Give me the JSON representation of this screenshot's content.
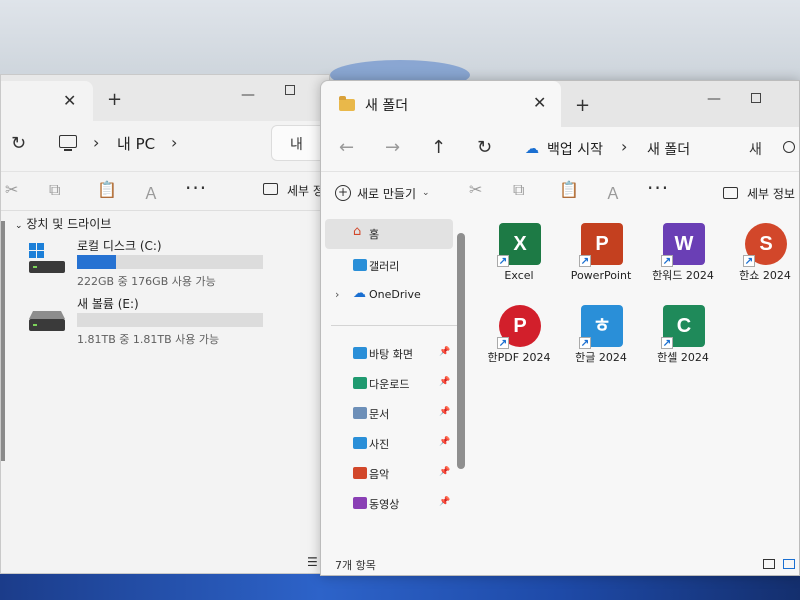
{
  "back_window": {
    "breadcrumb": "내 PC",
    "search_fragment": "내",
    "details_label": "세부 정",
    "section_title": "장치 및 드라이브",
    "drives": [
      {
        "name": "로컬 디스크 (C:)",
        "size_text": "222GB 중 176GB 사용 가능",
        "used_fraction": 0.21
      },
      {
        "name": "새 볼륨 (E:)",
        "size_text": "1.81TB 중 1.81TB 사용 가능",
        "used_fraction": 0.0
      }
    ]
  },
  "front_window": {
    "tab_title": "새 폴더",
    "breadcrumb": [
      "백업 시작",
      "새 폴더"
    ],
    "search_fragment": "새",
    "new_button_label": "새로 만들기",
    "details_label": "세부 정보",
    "sidebar": {
      "items": [
        {
          "label": "홈",
          "icon": "home-icon",
          "selected": true
        },
        {
          "label": "갤러리",
          "icon": "gallery-icon"
        },
        {
          "label": "OneDrive",
          "icon": "cloud-icon"
        },
        {
          "label": "바탕 화면",
          "icon": "desktop-folder-icon",
          "pinned": true
        },
        {
          "label": "다운로드",
          "icon": "downloads-folder-icon",
          "pinned": true
        },
        {
          "label": "문서",
          "icon": "documents-folder-icon",
          "pinned": true
        },
        {
          "label": "사진",
          "icon": "pictures-folder-icon",
          "pinned": true
        },
        {
          "label": "음악",
          "icon": "music-folder-icon",
          "pinned": true
        },
        {
          "label": "동영상",
          "icon": "videos-folder-icon",
          "pinned": true
        }
      ]
    },
    "files": [
      {
        "label": "Excel",
        "glyph": "X",
        "color": "#1d7a45",
        "icon": "excel-icon"
      },
      {
        "label": "PowerPoint",
        "glyph": "P",
        "color": "#c4401f",
        "icon": "powerpoint-icon"
      },
      {
        "label": "한워드 2024",
        "glyph": "W",
        "color": "#6a3fb5",
        "icon": "hanword-icon"
      },
      {
        "label": "한쇼 2024",
        "glyph": "S",
        "color": "#d2472a",
        "icon": "hanshow-icon"
      },
      {
        "label": "한PDF 2024",
        "glyph": "P",
        "color": "#d21f2b",
        "icon": "hanpdf-icon"
      },
      {
        "label": "한글 2024",
        "glyph": "ㅎ",
        "color": "#2a8fd8",
        "icon": "hangul-icon"
      },
      {
        "label": "한셀 2024",
        "glyph": "C",
        "color": "#1f8a5a",
        "icon": "hancell-icon"
      }
    ],
    "status_text": "7개 항목"
  }
}
